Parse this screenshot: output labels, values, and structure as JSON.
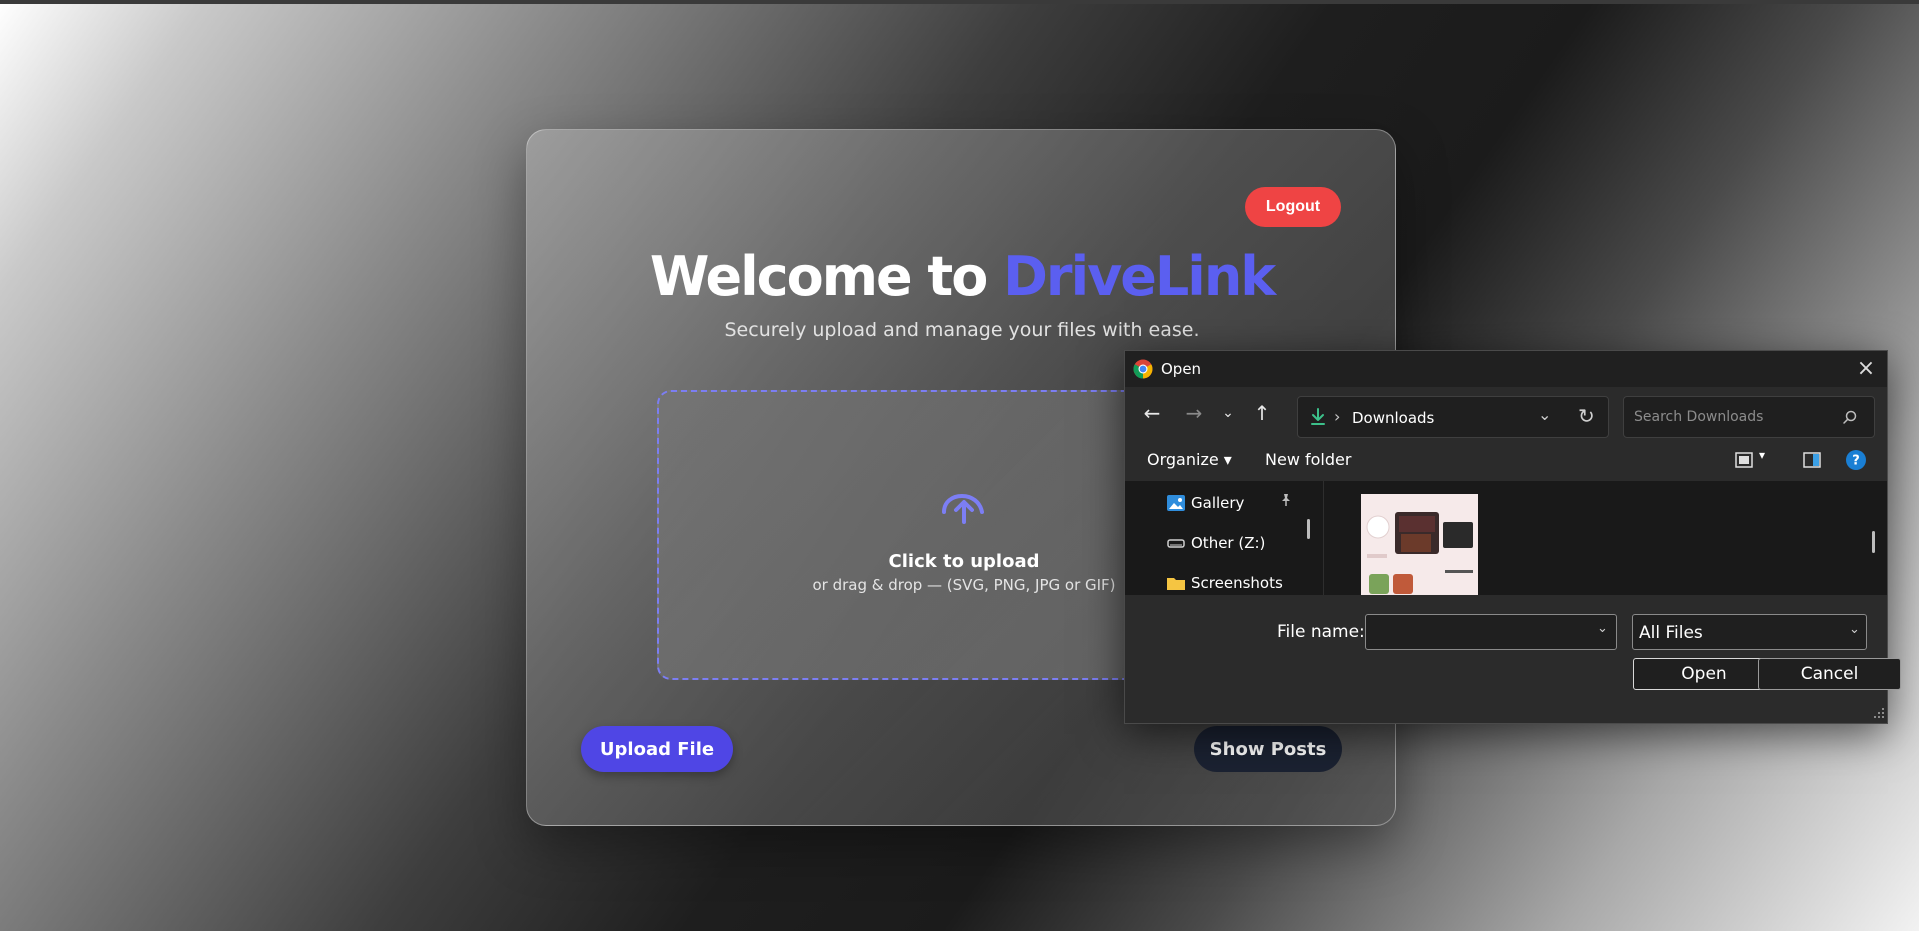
{
  "app": {
    "logout_label": "Logout",
    "title_prefix": "Welcome to ",
    "title_brand": "DriveLink",
    "subtitle": "Securely upload and manage your files with ease.",
    "dropzone": {
      "title": "Click to upload",
      "subtitle": "or drag & drop — (SVG, PNG, JPG or GIF)"
    },
    "upload_button": "Upload File",
    "show_posts_button": "Show Posts",
    "colors": {
      "brand": "#5b5ff0",
      "logout": "#ef4444",
      "upload": "#4f46e5",
      "posts": "#1b2232"
    }
  },
  "dialog": {
    "title": "Open",
    "icon": "chrome-icon",
    "address": {
      "separator": "›",
      "location": "Downloads"
    },
    "search_placeholder": "Search Downloads",
    "commands": {
      "organize": "Organize ▾",
      "new_folder": "New folder"
    },
    "nav_items": [
      {
        "label": "Gallery",
        "icon": "gallery-icon"
      },
      {
        "label": "Other (Z:)",
        "icon": "drive-icon"
      },
      {
        "label": "Screenshots",
        "icon": "folder-icon"
      }
    ],
    "file_name_label": "File name:",
    "file_name_value": "",
    "file_type": "All Files",
    "open_button": "Open",
    "cancel_button": "Cancel"
  }
}
